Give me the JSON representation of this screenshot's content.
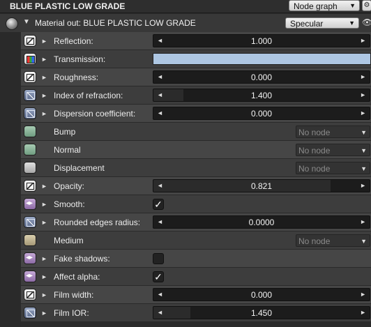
{
  "header": {
    "title": "BLUE PLASTIC LOW GRADE",
    "view_select": "Node graph",
    "settings_icon": "gear-icon"
  },
  "material": {
    "label": "Material out: BLUE PLASTIC LOW GRADE",
    "type_select": "Specular",
    "visibility_icon": "eye-icon"
  },
  "rows": [
    {
      "kind": "slider",
      "icon": "texture",
      "label": "Reflection:",
      "value": "1.000",
      "fill": 0
    },
    {
      "kind": "color",
      "icon": "rgb",
      "label": "Transmission:",
      "color": "#aec7e3"
    },
    {
      "kind": "slider",
      "icon": "texture",
      "label": "Roughness:",
      "value": "0.000",
      "fill": 0
    },
    {
      "kind": "slider",
      "icon": "float",
      "label": "Index of refraction:",
      "value": "1.400",
      "fill": 0.14
    },
    {
      "kind": "slider",
      "icon": "float",
      "label": "Dispersion coefficient:",
      "value": "0.000",
      "fill": 0
    },
    {
      "kind": "node",
      "icon": "green",
      "label": "Bump",
      "value": "No node"
    },
    {
      "kind": "node",
      "icon": "green",
      "label": "Normal",
      "value": "No node"
    },
    {
      "kind": "node",
      "icon": "grey",
      "label": "Displacement",
      "value": "No node"
    },
    {
      "kind": "slider",
      "icon": "texture",
      "label": "Opacity:",
      "value": "0.821",
      "fill": 0.82
    },
    {
      "kind": "check",
      "icon": "bool",
      "label": "Smooth:",
      "checked": "✓"
    },
    {
      "kind": "slider",
      "icon": "float",
      "label": "Rounded edges radius:",
      "value": "0.0000",
      "fill": 0
    },
    {
      "kind": "node",
      "icon": "tan",
      "label": "Medium",
      "value": "No node"
    },
    {
      "kind": "check",
      "icon": "bool",
      "label": "Fake shadows:",
      "checked": ""
    },
    {
      "kind": "check",
      "icon": "bool",
      "label": "Affect alpha:",
      "checked": "✓"
    },
    {
      "kind": "slider",
      "icon": "texture",
      "label": "Film width:",
      "value": "0.000",
      "fill": 0
    },
    {
      "kind": "slider",
      "icon": "float",
      "label": "Film IOR:",
      "value": "1.450",
      "fill": 0.17
    }
  ]
}
